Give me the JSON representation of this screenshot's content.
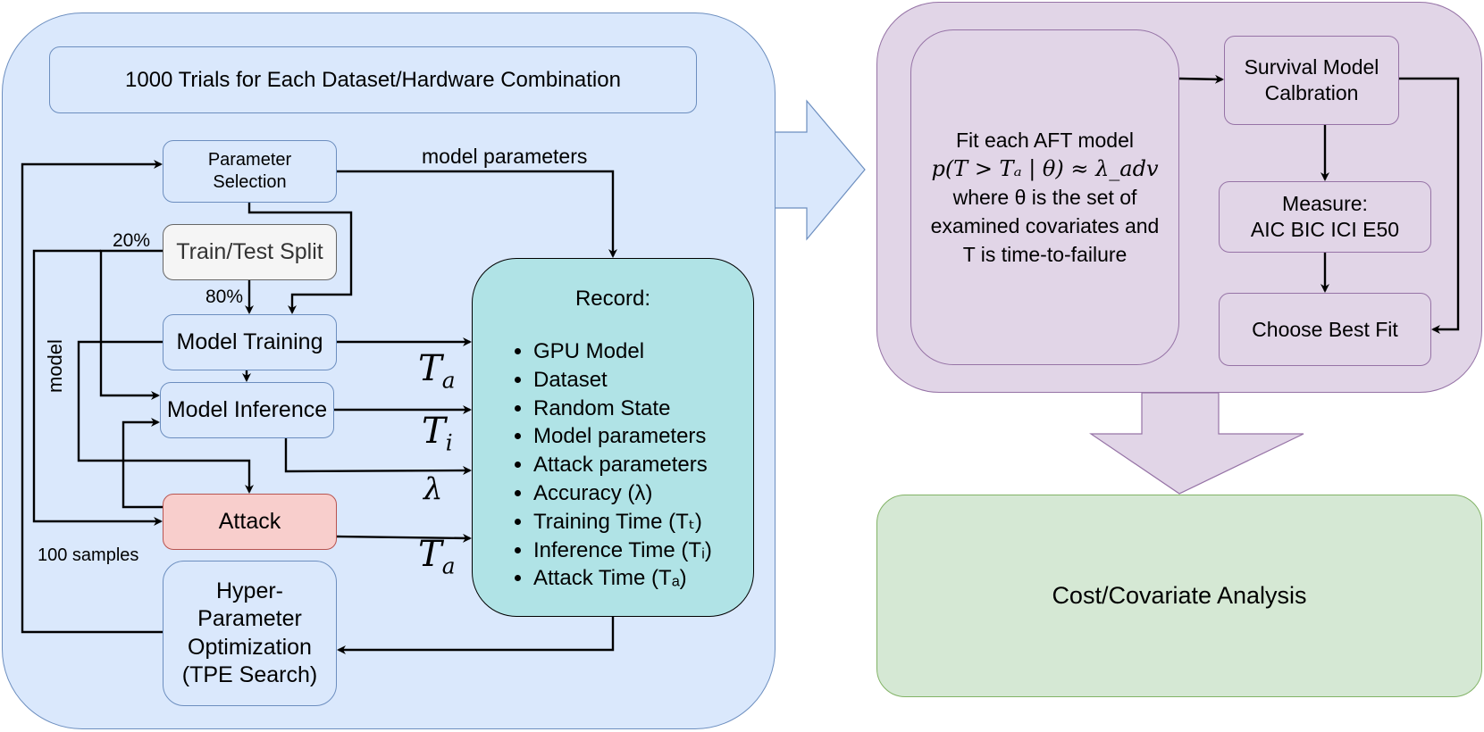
{
  "diagram": {
    "colors": {
      "experiment_fill": "#dae8fc",
      "experiment_stroke": "#6c8ebf",
      "split_fill": "#f5f5f5",
      "attack_fill": "#f8cecc",
      "attack_stroke": "#b85450",
      "record_fill": "#b0e3e6",
      "survival_fill": "#e1d5e7",
      "survival_stroke": "#9673a6",
      "analysis_fill": "#d5e8d4",
      "analysis_stroke": "#82b366"
    },
    "experiment": {
      "header": "1000 Trials for Each Dataset/Hardware Combination",
      "parameter_selection": [
        "Parameter",
        "Selection"
      ],
      "train_test_split": "Train/Test Split",
      "model_training": "Model Training",
      "model_inference": "Model Inference",
      "attack": "Attack",
      "hpo": [
        "Hyper-",
        "Parameter",
        "Optimization",
        "(TPE Search)"
      ],
      "edge_labels": {
        "model_parameters": "model parameters",
        "test_pct": "20%",
        "train_pct": "80%",
        "model": "model",
        "samples": "100 samples",
        "t_train": {
          "base": "T",
          "sub": "a"
        },
        "t_inference": {
          "base": "T",
          "sub": "i"
        },
        "accuracy": "λ",
        "t_attack": {
          "base": "T",
          "sub": "a"
        }
      },
      "record": {
        "title": "Record:",
        "items": [
          "GPU Model",
          "Dataset",
          "Random State",
          "Model parameters",
          "Attack parameters",
          "Accuracy (λ)",
          "Training Time (Tₜ)",
          "Inference Time (Tᵢ)",
          "Attack  Time (Tₐ)"
        ]
      }
    },
    "survival": {
      "fit": {
        "line1": "Fit each AFT model",
        "formula": "p(T > Tₐ | θ) ≈  λ_adv",
        "line3": "where θ is the set of",
        "line4": "examined covariates and",
        "line5": "T is time-to-failure"
      },
      "calibration": [
        "Survival Model",
        "Calbration"
      ],
      "measure": [
        "Measure:",
        "AIC BIC ICI E50"
      ],
      "choose": "Choose Best Fit"
    },
    "analysis": {
      "label": "Cost/Covariate Analysis"
    }
  }
}
